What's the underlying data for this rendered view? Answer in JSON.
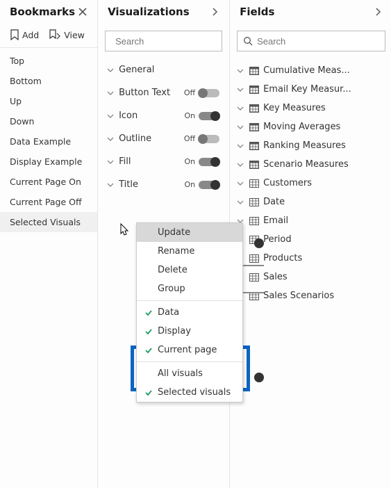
{
  "bookmarks": {
    "title": "Bookmarks",
    "toolbar": {
      "add": "Add",
      "view": "View"
    },
    "items": [
      "Top",
      "Bottom",
      "Up",
      "Down",
      "Data Example",
      "Display Example",
      "Current Page On",
      "Current Page Off",
      "Selected Visuals"
    ]
  },
  "visualizations": {
    "title": "Visualizations",
    "search_placeholder": "Search",
    "sections": [
      {
        "label": "General",
        "toggle": null
      },
      {
        "label": "Button Text",
        "toggle": "Off"
      },
      {
        "label": "Icon",
        "toggle": "On"
      },
      {
        "label": "Outline",
        "toggle": "Off"
      },
      {
        "label": "Fill",
        "toggle": "On"
      },
      {
        "label": "Title",
        "toggle": "On"
      }
    ]
  },
  "fields": {
    "title": "Fields",
    "search_placeholder": "Search",
    "items": [
      {
        "label": "Cumulative Meas...",
        "icon": "measure"
      },
      {
        "label": "Email Key Measur...",
        "icon": "measure"
      },
      {
        "label": "Key Measures",
        "icon": "measure"
      },
      {
        "label": "Moving Averages",
        "icon": "measure"
      },
      {
        "label": "Ranking Measures",
        "icon": "measure"
      },
      {
        "label": "Scenario Measures",
        "icon": "measure"
      },
      {
        "label": "Customers",
        "icon": "table"
      },
      {
        "label": "Date",
        "icon": "table"
      },
      {
        "label": "Email",
        "icon": "table"
      },
      {
        "label": "Period",
        "icon": "table"
      },
      {
        "label": "Products",
        "icon": "table"
      },
      {
        "label": "Sales",
        "icon": "table"
      },
      {
        "label": "Sales Scenarios",
        "icon": "table"
      }
    ]
  },
  "context_menu": {
    "items": [
      {
        "label": "Update",
        "checked": false,
        "hover": true
      },
      {
        "label": "Rename",
        "checked": false
      },
      {
        "label": "Delete",
        "checked": false
      },
      {
        "label": "Group",
        "checked": false
      },
      {
        "sep": true
      },
      {
        "label": "Data",
        "checked": true
      },
      {
        "label": "Display",
        "checked": true
      },
      {
        "label": "Current page",
        "checked": true
      },
      {
        "sep": true
      },
      {
        "label": "All visuals",
        "checked": false
      },
      {
        "label": "Selected visuals",
        "checked": true
      }
    ]
  }
}
